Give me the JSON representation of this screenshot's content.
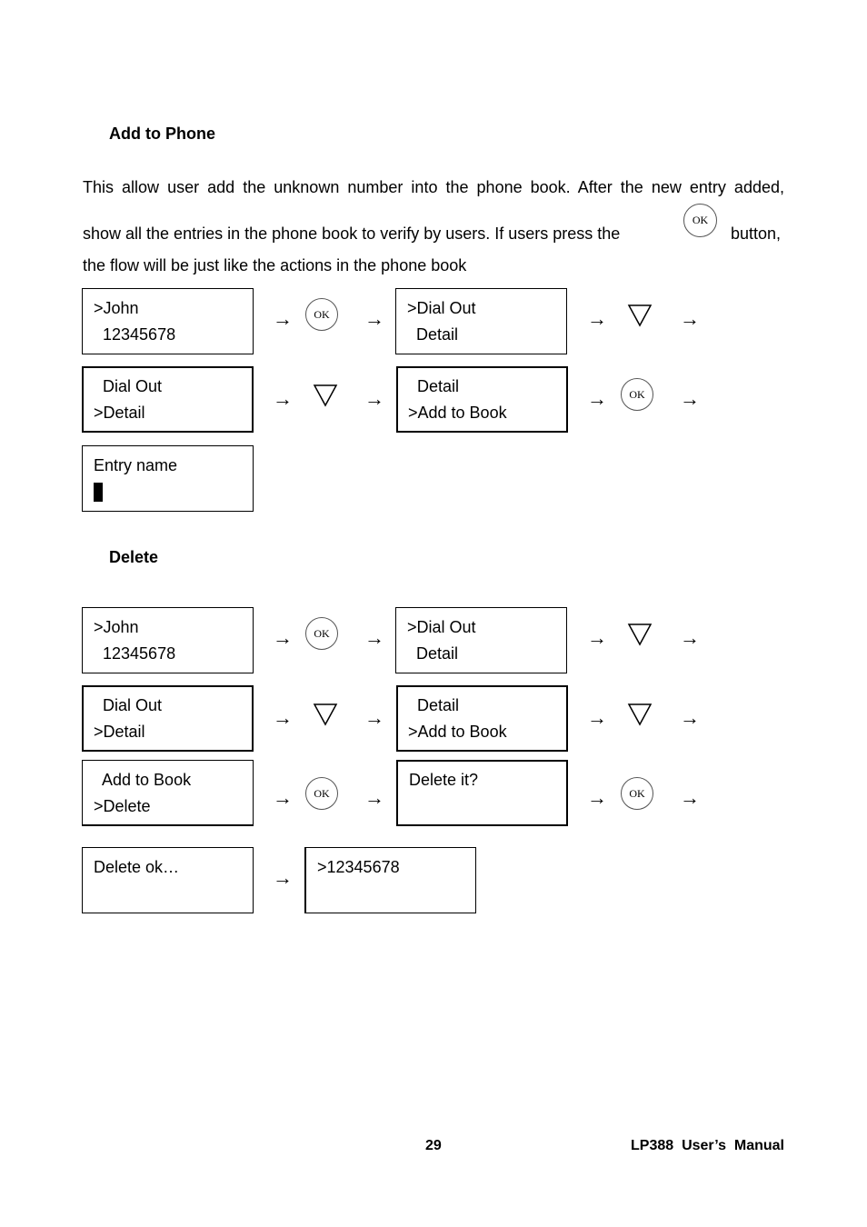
{
  "sections": {
    "add_to_phone": {
      "title": "Add to Phone",
      "paragraph": {
        "line1": "This allow user add the unknown number into the phone book. After the new entry added,",
        "line2_before": "show all the entries in the phone book to verify by users. If users press the",
        "line2_after": "button,",
        "line3": "the flow will be just like the actions in the phone book"
      },
      "screens": [
        {
          "line1": ">John",
          "line2": "  12345678"
        },
        {
          "line1": ">Dial Out",
          "line2": "  Detail"
        },
        {
          "line1": "  Dial Out",
          "line2": ">Detail"
        },
        {
          "line1": "  Detail",
          "line2": ">Add to Book"
        },
        {
          "line1": "Entry name",
          "line2": ""
        }
      ]
    },
    "delete": {
      "title": "Delete",
      "screens": [
        {
          "line1": ">John",
          "line2": "  12345678"
        },
        {
          "line1": ">Dial Out",
          "line2": "  Detail"
        },
        {
          "line1": "  Dial Out",
          "line2": ">Detail"
        },
        {
          "line1": "  Detail",
          "line2": ">Add to Book"
        },
        {
          "line1": "  Add to Book",
          "line2": ">Delete"
        },
        {
          "line1": "Delete it?",
          "line2": ""
        },
        {
          "line1": "Delete ok…",
          "line2": ""
        },
        {
          "line1": ">12345678",
          "line2": ""
        }
      ]
    }
  },
  "symbols": {
    "arrow": "→",
    "ok_label": "OK",
    "down_icon": "down-triangle"
  },
  "footer": {
    "page_number": "29",
    "manual_title": "LP388  User’s  Manual"
  }
}
